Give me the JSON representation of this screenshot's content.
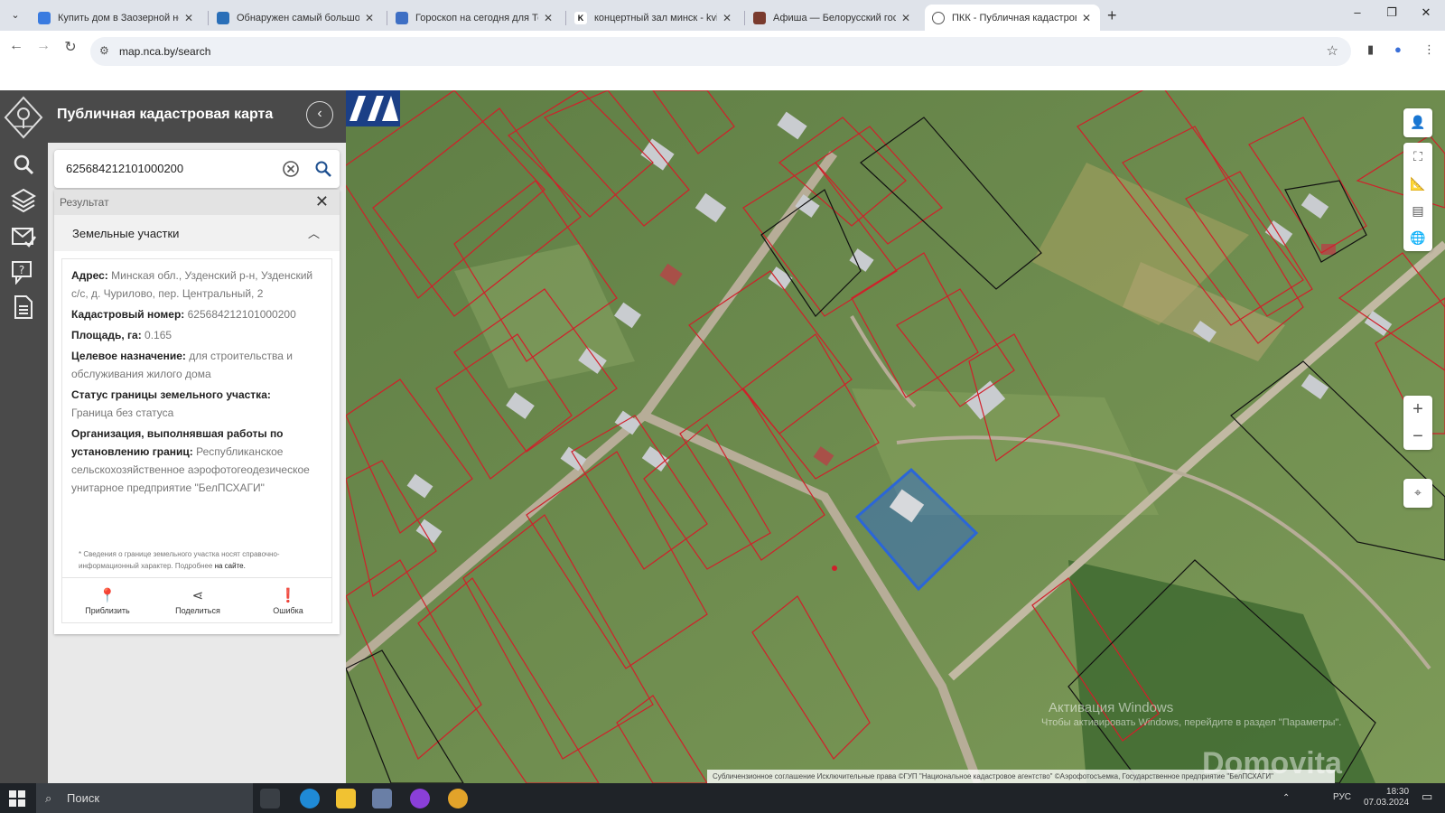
{
  "browser": {
    "tabs": [
      {
        "title": "Купить дом в Заозерной недв",
        "active": false
      },
      {
        "title": "Обнаружен самый большой с",
        "active": false
      },
      {
        "title": "Гороскоп на сегодня для Тел",
        "active": false
      },
      {
        "title": "концертный зал минск - kvitk",
        "active": false
      },
      {
        "title": "Афиша — Белорусский госуда",
        "active": false
      },
      {
        "title": "ПКК - Публичная кадастровая",
        "active": true
      }
    ],
    "tab_close": "✕",
    "new_tab": "+",
    "url": "map.nca.by/search"
  },
  "app": {
    "title": "Публичная кадастровая карта",
    "search_value": "625684212101000200",
    "result_label": "Результат",
    "section_label": "Земельные участки",
    "info": {
      "address_label": "Адрес:",
      "address_value": "Минская обл., Узденский р-н, Узденский с/с, д. Чурилово, пер. Центральный, 2",
      "cadastral_label": "Кадастровый номер:",
      "cadastral_value": "625684212101000200",
      "area_label": "Площадь, га:",
      "area_value": "0.165",
      "purpose_label": "Целевое назначение:",
      "purpose_value": "для строительства и обслуживания жилого дома",
      "status_label": "Статус границы земельного участка:",
      "status_value": "Граница без статуса",
      "org_label": "Организация, выполнявшая работы по установлению границ:",
      "org_value": "Республиканское сельскохозяйственное аэрофотогеодезическое унитарное предприятие \"БелПСХАГИ\""
    },
    "footnote": "* Сведения о границе земельного участка носят справочно-информационный характер. Подробнее",
    "footnote_link": "на сайте.",
    "actions": {
      "zoom": "Приблизить",
      "share": "Поделиться",
      "error": "Ошибка"
    }
  },
  "map": {
    "attribution": "Субличензионное соглашение   Исключительные права   ©ГУП \"Национальное кадастровое агентство\"   ©Аэрофотосъемка, Государственное предприятие \"БелПСХАГИ\"",
    "watermark_title": "Активация Windows",
    "watermark_sub": "Чтобы активировать Windows, перейдите в раздел \"Параметры\".",
    "domovita": "Domovita",
    "zoom_in": "+",
    "zoom_out": "−",
    "colors": {
      "parcel_border": "#d0202a",
      "selected_fill": "#2b66d8",
      "black_border": "#111111"
    }
  },
  "taskbar": {
    "search": "Поиск",
    "lang": "РУС",
    "time": "18:30",
    "date": "07.03.2024"
  }
}
